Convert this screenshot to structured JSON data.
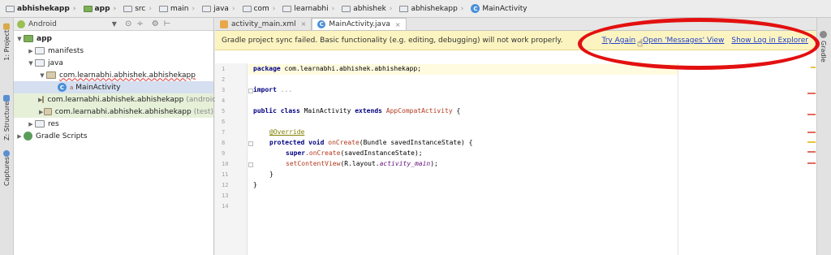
{
  "breadcrumbs": [
    {
      "label": "abhishekapp",
      "icon": "app-folder-icon"
    },
    {
      "label": "app",
      "icon": "app-module-icon"
    },
    {
      "label": "src",
      "icon": "folder-icon"
    },
    {
      "label": "main",
      "icon": "folder-icon"
    },
    {
      "label": "java",
      "icon": "folder-icon"
    },
    {
      "label": "com",
      "icon": "package-icon"
    },
    {
      "label": "learnabhi",
      "icon": "package-icon"
    },
    {
      "label": "abhishek",
      "icon": "package-icon"
    },
    {
      "label": "abhishekapp",
      "icon": "package-icon"
    },
    {
      "label": "MainActivity",
      "icon": "class-icon"
    }
  ],
  "left_strip": {
    "project_tab": "1: Project",
    "structure_tab": "Z: Structure",
    "captures_tab": "Captures"
  },
  "right_strip": {
    "gradle_tab": "Gradle"
  },
  "project_panel": {
    "view_selector": "Android",
    "tree": [
      {
        "label": "app",
        "depth": 0,
        "expanded": true,
        "icon": "app-folder-icon"
      },
      {
        "label": "manifests",
        "depth": 1,
        "expanded": false,
        "icon": "folder-icon"
      },
      {
        "label": "java",
        "depth": 1,
        "expanded": true,
        "icon": "folder-icon"
      },
      {
        "label": "com.learnabhi.abhishek.abhishekapp",
        "depth": 2,
        "expanded": true,
        "icon": "package-icon"
      },
      {
        "label": "MainActivity",
        "depth": 3,
        "icon": "class-icon",
        "selected": true
      },
      {
        "label": "com.learnabhi.abhishek.abhishekapp",
        "suffix": "(androidT",
        "depth": 2,
        "expanded": false,
        "icon": "package-icon"
      },
      {
        "label": "com.learnabhi.abhishek.abhishekapp",
        "suffix": "(test)",
        "depth": 2,
        "expanded": false,
        "icon": "package-icon"
      },
      {
        "label": "res",
        "depth": 1,
        "expanded": false,
        "icon": "folder-icon"
      },
      {
        "label": "Gradle Scripts",
        "depth": 0,
        "expanded": false,
        "icon": "gradle-icon"
      }
    ]
  },
  "tabs": [
    {
      "label": "activity_main.xml",
      "icon": "xml-file-icon",
      "active": false
    },
    {
      "label": "MainActivity.java",
      "icon": "java-class-icon",
      "active": true
    }
  ],
  "notification": {
    "message": "Gradle project sync failed. Basic functionality (e.g. editing, debugging) will not work properly.",
    "try_again": "Try Again",
    "open_messages": "Open 'Messages' View",
    "show_log": "Show Log in Explorer"
  },
  "editor": {
    "line_numbers": [
      "1",
      "2",
      "3",
      "4",
      "5",
      "6",
      "7",
      "8",
      "9",
      "10",
      "11",
      "12",
      "13",
      "14"
    ],
    "code": {
      "l1_kw": "package",
      "l1_rest": " com.learnabhi.abhishek.abhishekapp;",
      "l3_kw": "import",
      "l3_rest": " ...",
      "l5_kw": "public class",
      "l5_name": " MainActivity ",
      "l5_kw2": "extends",
      "l5_parent": " AppCompatActivity",
      "l5_brace": " {",
      "l7_ann": "@Override",
      "l8_kw": "protected void",
      "l8_fn": " onCreate",
      "l8_rest": "(Bundle savedInstanceState) {",
      "l9_kw": "super",
      "l9_fn": ".onCreate",
      "l9_rest": "(savedInstanceState);",
      "l10_fn": "setContentView",
      "l10_rest": "(R.layout.",
      "l10_ital": "activity_main",
      "l10_end": ");",
      "l11": "}",
      "l13": "}"
    }
  },
  "colors": {
    "annotation_circle": "#e31010",
    "link": "#2240c9",
    "notification_bg": "#fcf4c0"
  }
}
